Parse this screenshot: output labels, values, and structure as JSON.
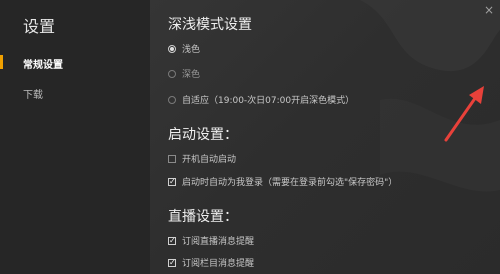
{
  "window": {
    "close_glyph": "×"
  },
  "sidebar": {
    "title": "设置",
    "items": [
      {
        "label": "常规设置",
        "active": true
      },
      {
        "label": "下载",
        "active": false
      }
    ],
    "accent_color": "#f0a000"
  },
  "theme_section": {
    "title": "深浅模式设置",
    "options": [
      {
        "label": "浅色",
        "checked": true
      },
      {
        "label": "深色",
        "checked": false
      },
      {
        "label": "自适应（19:00-次日07:00开启深色模式）",
        "checked": false
      }
    ]
  },
  "startup_section": {
    "title": "启动设置：",
    "options": [
      {
        "label": "开机自动启动",
        "checked": false
      },
      {
        "label": "启动时自动为我登录（需要在登录前勾选\"保存密码\"）",
        "checked": true
      }
    ]
  },
  "live_section": {
    "title": "直播设置：",
    "options": [
      {
        "label": "订阅直播消息提醒",
        "checked": true
      },
      {
        "label": "订阅栏目消息提醒",
        "checked": true
      }
    ]
  },
  "annotation": {
    "arrow_color": "#e8413a"
  }
}
